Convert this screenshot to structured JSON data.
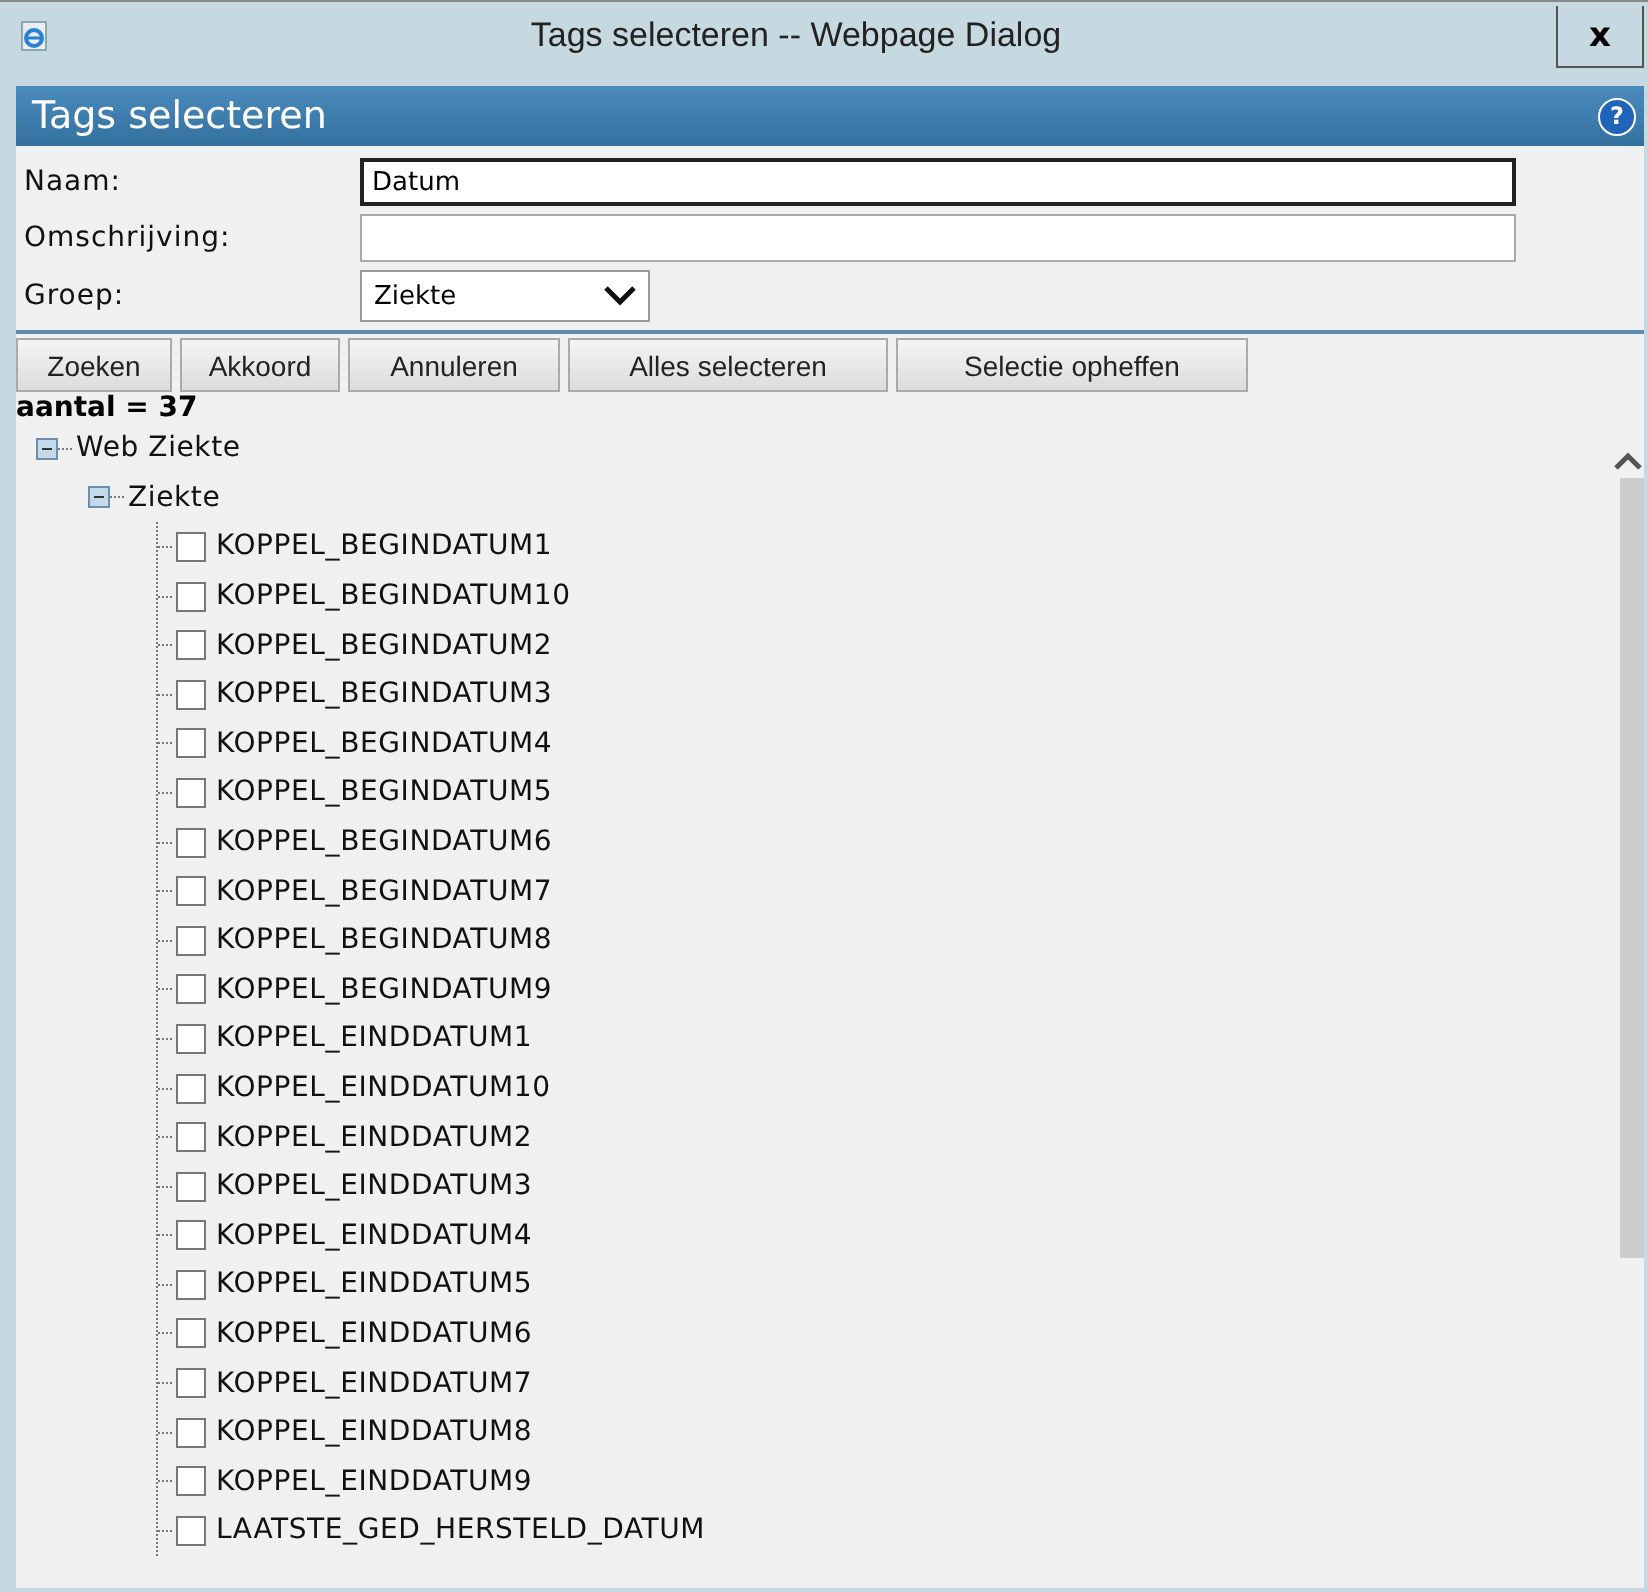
{
  "window": {
    "title": "Tags selecteren -- Webpage Dialog",
    "close": "x"
  },
  "header": {
    "title": "Tags selecteren",
    "help": "?"
  },
  "form": [
    {
      "label": "Naam:",
      "kind": "text",
      "value": "Datum",
      "focused": true
    },
    {
      "label": "Omschrijving:",
      "kind": "text",
      "focused": false
    },
    {
      "label": "Groep:",
      "kind": "select",
      "value": "Ziekte"
    }
  ],
  "buttons": [
    "Zoeken",
    "Akkoord",
    "Annuleren",
    "Alles selecteren",
    "Selectie opheffen"
  ],
  "count": "aantal = 37",
  "tree": [
    {
      "label": "Web Ziekte",
      "expanded": true,
      "children": [
        {
          "label": "Ziekte",
          "expanded": true,
          "children": [
            {
              "label": "KOPPEL_BEGINDATUM1",
              "checked": false
            },
            {
              "label": "KOPPEL_BEGINDATUM10",
              "checked": false
            },
            {
              "label": "KOPPEL_BEGINDATUM2",
              "checked": false
            },
            {
              "label": "KOPPEL_BEGINDATUM3",
              "checked": false
            },
            {
              "label": "KOPPEL_BEGINDATUM4",
              "checked": false
            },
            {
              "label": "KOPPEL_BEGINDATUM5",
              "checked": false
            },
            {
              "label": "KOPPEL_BEGINDATUM6",
              "checked": false
            },
            {
              "label": "KOPPEL_BEGINDATUM7",
              "checked": false
            },
            {
              "label": "KOPPEL_BEGINDATUM8",
              "checked": false
            },
            {
              "label": "KOPPEL_BEGINDATUM9",
              "checked": false
            },
            {
              "label": "KOPPEL_EINDDATUM1",
              "checked": false
            },
            {
              "label": "KOPPEL_EINDDATUM10",
              "checked": false
            },
            {
              "label": "KOPPEL_EINDDATUM2",
              "checked": false
            },
            {
              "label": "KOPPEL_EINDDATUM3",
              "checked": false
            },
            {
              "label": "KOPPEL_EINDDATUM4",
              "checked": false
            },
            {
              "label": "KOPPEL_EINDDATUM5",
              "checked": false
            },
            {
              "label": "KOPPEL_EINDDATUM6",
              "checked": false
            },
            {
              "label": "KOPPEL_EINDDATUM7",
              "checked": false
            },
            {
              "label": "KOPPEL_EINDDATUM8",
              "checked": false
            },
            {
              "label": "KOPPEL_EINDDATUM9",
              "checked": false
            },
            {
              "label": "LAATSTE_GED_HERSTELD_DATUM",
              "checked": false
            }
          ]
        }
      ]
    }
  ]
}
